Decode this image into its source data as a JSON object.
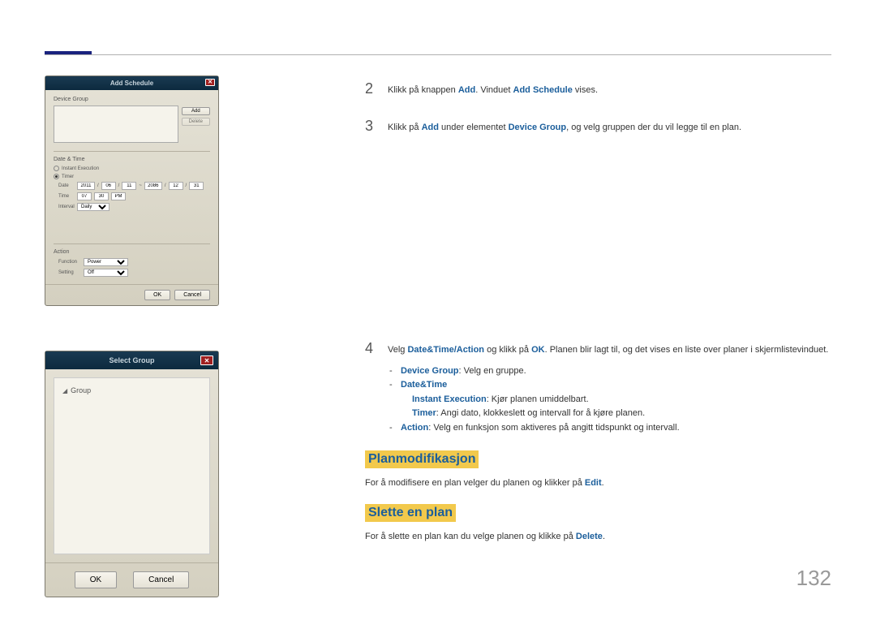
{
  "page_num": "132",
  "dialog1": {
    "title": "Add Schedule",
    "device_group_label": "Device Group",
    "add_btn": "Add",
    "delete_btn": "Delete",
    "datetime_label": "Date & Time",
    "instant_label": "Instant Execution",
    "timer_label": "Timer",
    "date_label": "Date",
    "time_label": "Time",
    "interval_label": "Interval",
    "date_y1": "2011",
    "date_m1": "06",
    "date_d1": "11",
    "date_y2": "2086",
    "date_m2": "12",
    "date_d2": "31",
    "time_h": "07",
    "time_m": "30",
    "time_ampm": "PM",
    "interval_val": "Daily",
    "action_label": "Action",
    "function_label": "Function",
    "setting_label": "Setting",
    "function_val": "Power",
    "setting_val": "Off",
    "ok_btn": "OK",
    "cancel_btn": "Cancel"
  },
  "dialog2": {
    "title": "Select Group",
    "group_item": "Group",
    "ok_btn": "OK",
    "cancel_btn": "Cancel"
  },
  "steps": {
    "s2_num": "2",
    "s2_pre": "Klikk på knappen ",
    "s2_add": "Add",
    "s2_mid": ". Vinduet ",
    "s2_addschedule": "Add Schedule",
    "s2_post": " vises.",
    "s3_num": "3",
    "s3_pre": "Klikk på ",
    "s3_add": "Add",
    "s3_mid": " under elementet ",
    "s3_dg": "Device Group",
    "s3_post": ", og velg gruppen der du vil legge til en plan.",
    "s4_num": "4",
    "s4_pre": "Velg ",
    "s4_dta": "Date&Time/Action",
    "s4_mid": " og klikk på ",
    "s4_ok": "OK",
    "s4_post": ". Planen blir lagt til, og det vises en liste over planer i skjermlistevinduet.",
    "bullet_dg": "Device Group",
    "bullet_dg_text": ": Velg en gruppe.",
    "bullet_dt": "Date&Time",
    "bullet_ie": "Instant Execution",
    "bullet_ie_text": ": Kjør planen umiddelbart.",
    "bullet_timer": "Timer",
    "bullet_timer_text": ": Angi dato, klokkeslett og intervall for å kjøre planen.",
    "bullet_action": "Action",
    "bullet_action_text": ": Velg en funksjon som aktiveres på angitt tidspunkt og intervall."
  },
  "mod_heading": "Planmodifikasjon",
  "mod_pre": "For å modifisere en plan velger du planen og klikker på ",
  "mod_edit": "Edit",
  "mod_post": ".",
  "del_heading": "Slette en plan",
  "del_pre": "For å slette en plan kan du velge planen og klikke på ",
  "del_delete": "Delete",
  "del_post": "."
}
